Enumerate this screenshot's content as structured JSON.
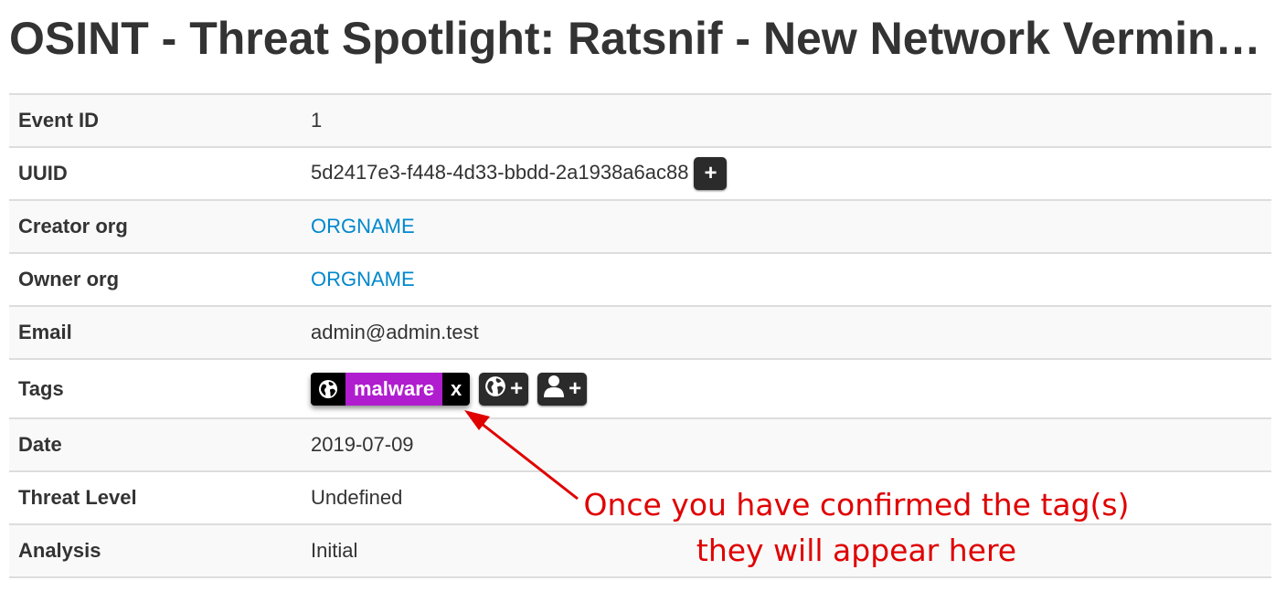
{
  "page": {
    "title": "OSINT - Threat Spotlight: Ratsnif - New Network Vermin…"
  },
  "event": {
    "event_id_label": "Event ID",
    "event_id": "1",
    "uuid_label": "UUID",
    "uuid": "5d2417e3-f448-4d33-bbdd-2a1938a6ac88",
    "uuid_button": "+",
    "creator_org_label": "Creator org",
    "creator_org": "ORGNAME",
    "owner_org_label": "Owner org",
    "owner_org": "ORGNAME",
    "email_label": "Email",
    "email": "admin@admin.test",
    "tags_label": "Tags",
    "date_label": "Date",
    "date": "2019-07-09",
    "threat_level_label": "Threat Level",
    "threat_level": "Undefined",
    "analysis_label": "Analysis",
    "analysis": "Initial"
  },
  "tags": {
    "items": [
      {
        "name": "malware",
        "remove": "x",
        "icon": "globe-icon",
        "color": "#b01dcf"
      }
    ],
    "add_global_plus": "+",
    "add_local_plus": "+",
    "add_global_icon": "globe-icon",
    "add_local_icon": "user-icon"
  },
  "annotation": {
    "line1": "Once you have confirmed the tag(s)",
    "line2": "they will appear here",
    "color": "#e00000"
  }
}
